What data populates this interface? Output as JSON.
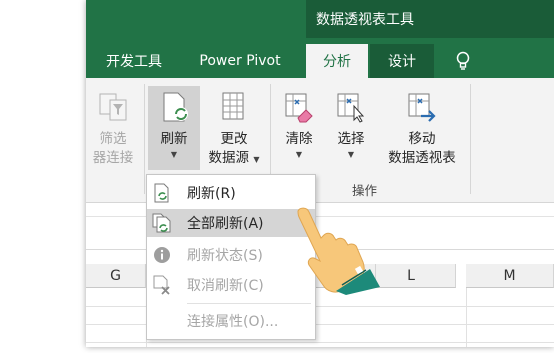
{
  "context_tab_header": "数据透视表工具",
  "tabs": [
    {
      "label": "开发工具"
    },
    {
      "label": "Power Pivot"
    },
    {
      "label": "分析",
      "active": true
    },
    {
      "label": "设计"
    }
  ],
  "help_icon": "lightbulb-icon",
  "ribbon": {
    "filter_connections": {
      "line1": "筛选",
      "line2": "器连接"
    },
    "refresh": {
      "label": "刷新"
    },
    "change_source": {
      "line1": "更改",
      "line2": "数据源"
    },
    "clear": {
      "label": "清除"
    },
    "select": {
      "label": "选择"
    },
    "move": {
      "line1": "移动",
      "line2": "数据透视表"
    },
    "actions_group_label": "操作"
  },
  "refresh_menu": [
    {
      "label": "刷新(R)",
      "state": "normal"
    },
    {
      "label": "全部刷新(A)",
      "state": "hover"
    },
    {
      "label": "刷新状态(S)",
      "state": "disabled"
    },
    {
      "label": "取消刷新(C)",
      "state": "disabled"
    },
    {
      "label": "连接属性(O)...",
      "state": "disabled"
    }
  ],
  "column_headers": [
    "G",
    "L",
    "M"
  ],
  "colors": {
    "excel_green": "#217346",
    "dark_green": "#1a5c38",
    "ribbon_bg": "#f3f3f3",
    "hand_yellow": "#f7c77a",
    "sleeve_teal": "#1d8a7a"
  }
}
